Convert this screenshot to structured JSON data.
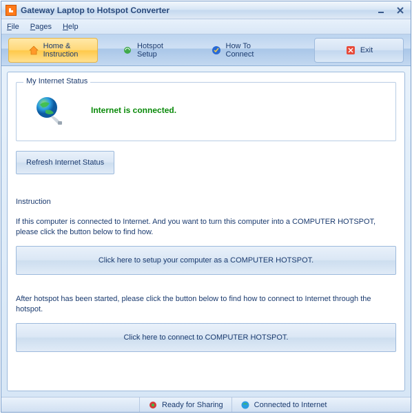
{
  "window": {
    "title": "Gateway Laptop to Hotspot Converter"
  },
  "menu": {
    "file": "File",
    "pages": "Pages",
    "help": "Help"
  },
  "tabs": {
    "home_line1": "Home &",
    "home_line2": "Instruction",
    "hotspot_line1": "Hotspot",
    "hotspot_line2": "Setup",
    "howto_line1": "How To",
    "howto_line2": "Connect",
    "exit": "Exit"
  },
  "status": {
    "legend": "My Internet Status",
    "message": "Internet is connected.",
    "refresh_btn": "Refresh Internet Status"
  },
  "instruction": {
    "heading": "Instruction",
    "para1": "If this computer is connected to Internet. And you want to turn this computer into a COMPUTER HOTSPOT, please click the button below to find how.",
    "btn1": "Click here to setup your computer as a COMPUTER HOTSPOT.",
    "para2": "After hotspot has been started, please click the button below to find how to connect to Internet through the hotspot.",
    "btn2": "Click here to connect to COMPUTER HOTSPOT."
  },
  "statusbar": {
    "sharing": "Ready for Sharing",
    "internet": "Connected to Internet"
  }
}
